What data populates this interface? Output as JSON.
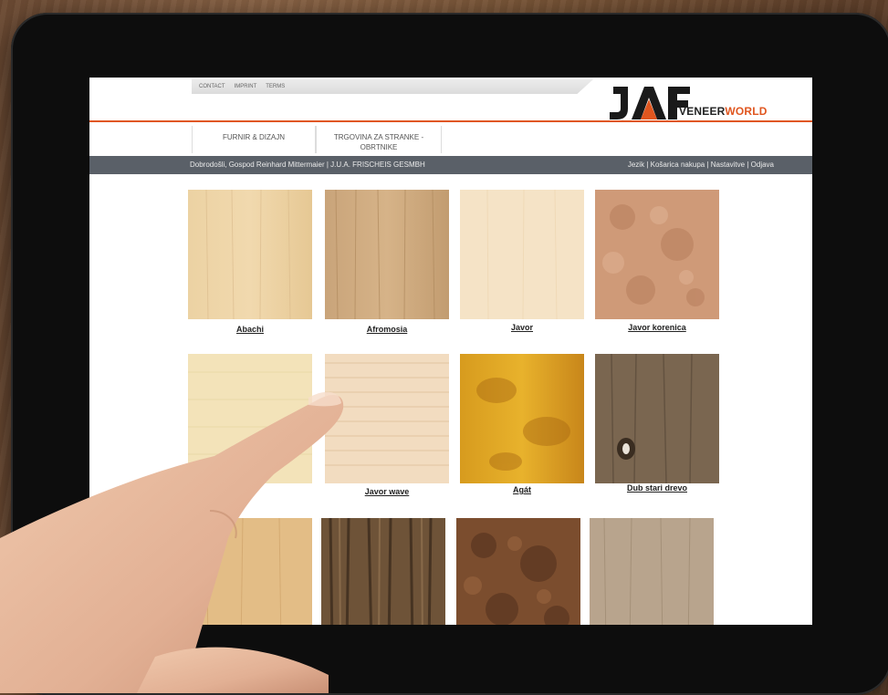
{
  "header": {
    "toplinks": [
      "CONTACT",
      "IMPRINT",
      "TERMS"
    ],
    "logo_brand": "VENEER",
    "logo_brand_accent": "WORLD",
    "logo_mark": "JAF",
    "accent_color": "#e0561f"
  },
  "menu": {
    "items": [
      "FURNIR & DIZAJN",
      "TRGOVINA ZA STRANKE - OBRTNIKE"
    ]
  },
  "status_bar": {
    "greeting": "Dobrodošli, Gospod Reinhard Mittermaier | J.U.A. FRISCHEIS GESMBH",
    "links": [
      "Jezik",
      "Košarica nakupa",
      "Nastavitve",
      "Odjava"
    ],
    "separator": " | "
  },
  "catalog": {
    "items": [
      {
        "label": "Abachi",
        "texture": "abachi"
      },
      {
        "label": "Afromosia",
        "texture": "afromosia"
      },
      {
        "label": "Javor",
        "texture": "javor"
      },
      {
        "label": "Javor korenica",
        "texture": "javor-korenica"
      },
      {
        "label": "",
        "texture": "sicomoro"
      },
      {
        "label": "Javor wave",
        "texture": "javor-wave"
      },
      {
        "label": "Agát",
        "texture": "agat"
      },
      {
        "label": "Dub stari drevo",
        "texture": "dub-stari"
      },
      {
        "label": "",
        "texture": "light-oak"
      },
      {
        "label": "",
        "texture": "striped-walnut"
      },
      {
        "label": "",
        "texture": "burl"
      },
      {
        "label": "",
        "texture": "grey-oak"
      }
    ]
  }
}
